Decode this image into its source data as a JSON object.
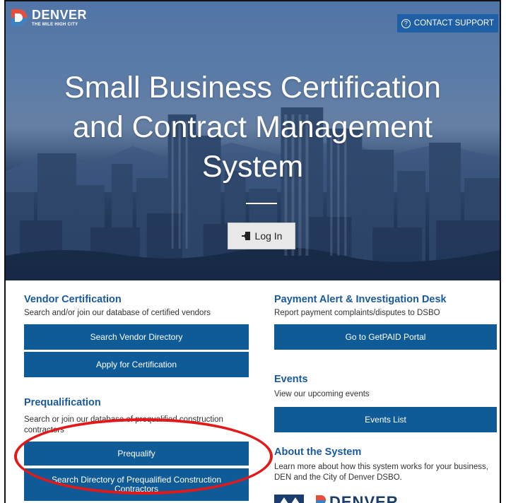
{
  "header": {
    "brand_name": "DENVER",
    "brand_tagline": "THE MILE HIGH CITY",
    "support_label": "CONTACT SUPPORT"
  },
  "hero": {
    "title_line1": "Small Business Certification",
    "title_line2": "and Contract Management",
    "title_line3": "System",
    "login_label": "Log In"
  },
  "vendor": {
    "title": "Vendor Certification",
    "desc": "Search and/or join our database of certified vendors",
    "btn_search": "Search Vendor Directory",
    "btn_apply": "Apply for Certification"
  },
  "prequal": {
    "title": "Prequalification",
    "desc": "Search or join our database of prequalified construction contractors",
    "btn_prequalify": "Prequalify",
    "btn_search_line1": "Search Directory of Prequalified Construction",
    "btn_search_line2": "Contractors"
  },
  "payment": {
    "title": "Payment Alert & Investigation Desk",
    "desc": "Report payment complaints/disputes to DSBO",
    "btn": "Go to GetPAID Portal"
  },
  "events": {
    "title": "Events",
    "desc": "View our upcoming events",
    "btn": "Events List"
  },
  "about": {
    "title": "About the System",
    "desc_line1": "Learn more about how this system works for your business,",
    "desc_line2": "DEN and the City of Denver DSBO.",
    "logo_text": "DENVER"
  },
  "colors": {
    "brand_blue": "#0f5b97",
    "title_blue": "#1a5a9c",
    "annotation_red": "#e31919"
  }
}
